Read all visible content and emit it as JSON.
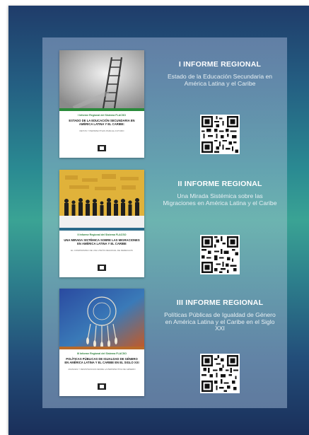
{
  "reports": [
    {
      "heading": "I INFORME REGIONAL",
      "description": "Estado de la Educación Secundaria en América Latina y el Caribe",
      "cover": {
        "kicker": "I Informe Regional del Sistema FLACSO",
        "title": "ESTADO DE LA EDUCACIÓN SECUNDARIA EN AMÉRICA LATINA Y EL CARIBE:",
        "subtitle": "RETOS Y PERSPECTIVAS PARA EL FUTURO",
        "band_color": "#2a8a3a",
        "art": "ladder-icon"
      }
    },
    {
      "heading": "II INFORME REGIONAL",
      "description": "Una Mirada Sistémica sobre las Migraciones en América Latina y el Caribe",
      "cover": {
        "kicker": "II Informe Regional del Sistema FLACSO",
        "title": "UNA MIRADA SISTÉMICA SOBRE LAS MIGRACIONES EN AMÉRICA LATINA Y EL CARIBE",
        "subtitle": "EL COMPROMISO DE UNA VISIÓN REGIONAL DE DERECHOS",
        "band_color": "#2a6a8a",
        "art": "migrants-icon"
      }
    },
    {
      "heading": "III INFORME REGIONAL",
      "description": "Políticas Públicas de Igualdad de Género en América Latina y el Caribe en el Siglo XXI",
      "cover": {
        "kicker": "III Informe Regional del Sistema FLACSO",
        "title": "POLÍTICAS PÚBLICAS DE IGUALDAD DE GÉNERO EN AMÉRICA LATINA Y EL CARIBE EN EL SIGLO XXI",
        "subtitle": "AVANCES Y RESISTENCIAS DESDE LA PERSPECTIVA DE GÉNERO",
        "band_color": "#b86a2a",
        "art": "dreamcatcher-icon"
      }
    }
  ]
}
